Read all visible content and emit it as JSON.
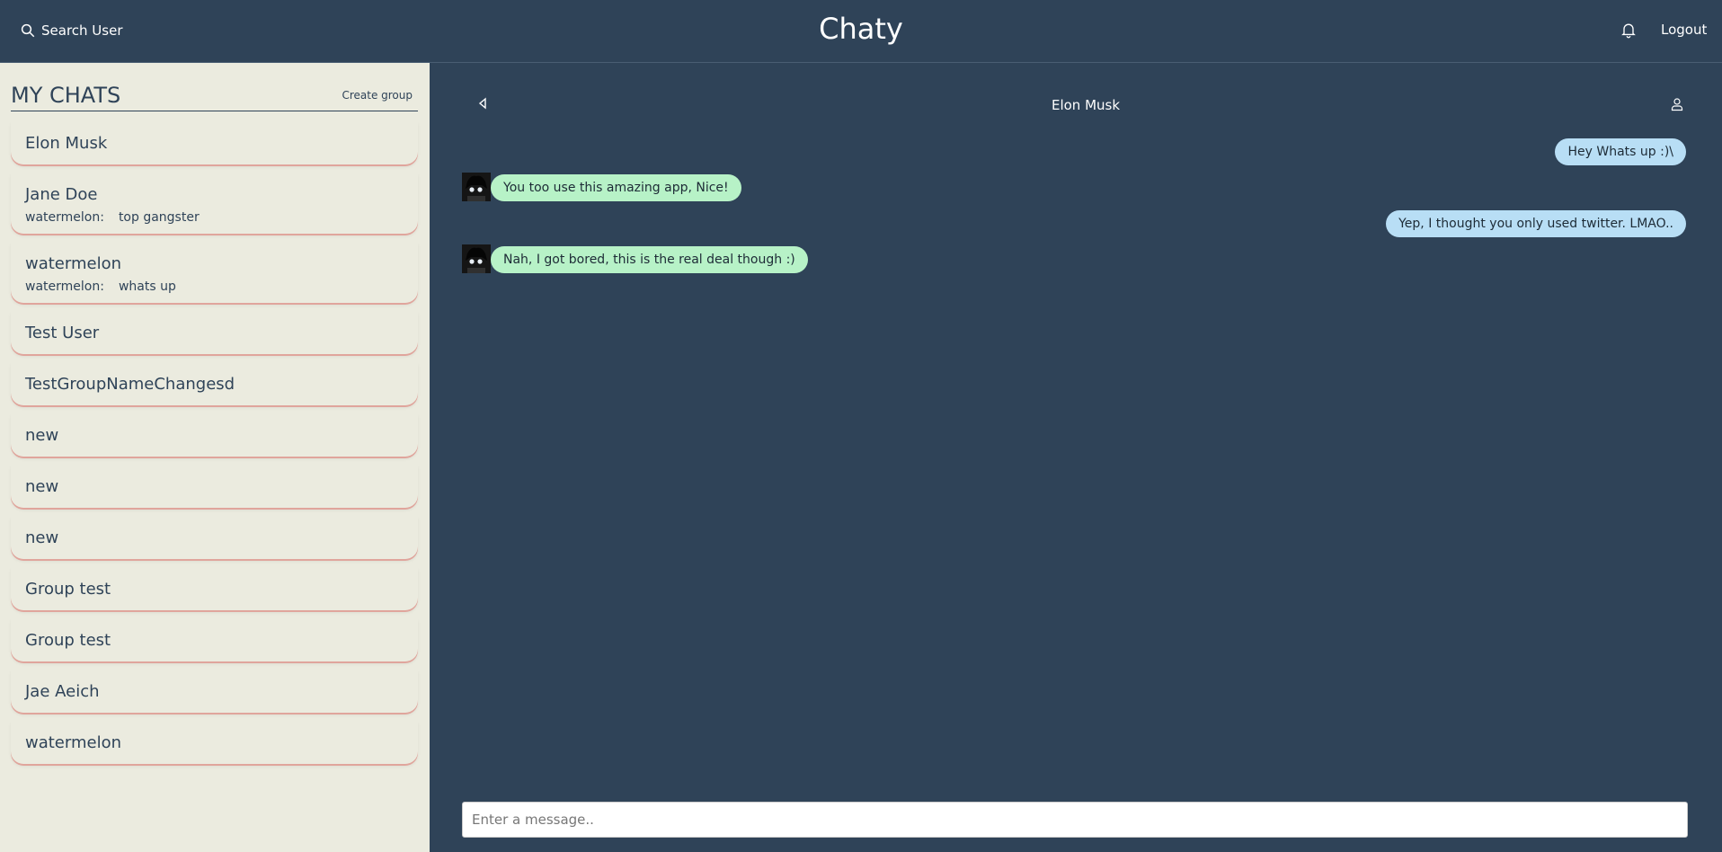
{
  "header": {
    "search_label": "Search User",
    "app_title": "Chaty",
    "logout_label": "Logout"
  },
  "sidebar": {
    "title": "MY CHATS",
    "create_group_label": "Create group",
    "chats": [
      {
        "name": "Elon Musk"
      },
      {
        "name": "Jane Doe",
        "latest_sender": "watermelon:",
        "latest_message": "top gangster"
      },
      {
        "name": "watermelon",
        "latest_sender": "watermelon:",
        "latest_message": "whats up"
      },
      {
        "name": "Test User"
      },
      {
        "name": "TestGroupNameChangesd"
      },
      {
        "name": "new"
      },
      {
        "name": "new"
      },
      {
        "name": "new"
      },
      {
        "name": "Group test"
      },
      {
        "name": "Group test"
      },
      {
        "name": "Jae Aeich"
      },
      {
        "name": "watermelon"
      }
    ]
  },
  "chat": {
    "title": "Elon Musk",
    "messages": [
      {
        "direction": "sent",
        "text": "Hey Whats up :)\\"
      },
      {
        "direction": "received",
        "text": "You too use this amazing app, Nice!"
      },
      {
        "direction": "sent",
        "text": "Yep, I thought you only used twitter. LMAO.."
      },
      {
        "direction": "received",
        "text": "Nah, I got bored, this is the real deal though :)"
      }
    ],
    "input_placeholder": "Enter a message.."
  },
  "colors": {
    "header_bg": "#2f4358",
    "sidebar_bg": "#ebebdf",
    "sent_bubble": "#b8def5",
    "received_bubble": "#b7f2c7",
    "chat_item_accent": "#e0a59c"
  }
}
